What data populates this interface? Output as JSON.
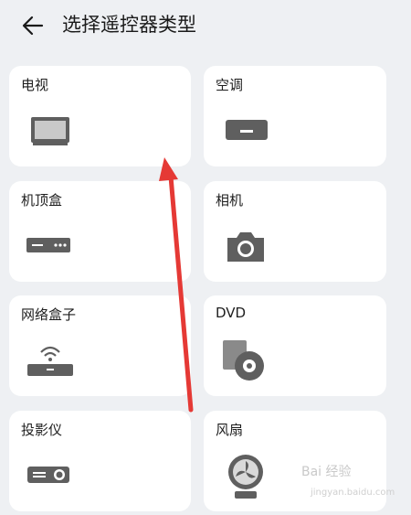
{
  "header": {
    "title": "选择遥控器类型"
  },
  "devices": [
    {
      "label": "电视",
      "icon": "tv-icon"
    },
    {
      "label": "空调",
      "icon": "air-conditioner-icon"
    },
    {
      "label": "机顶盒",
      "icon": "set-top-box-icon"
    },
    {
      "label": "相机",
      "icon": "camera-icon"
    },
    {
      "label": "网络盒子",
      "icon": "network-box-icon"
    },
    {
      "label": "DVD",
      "icon": "dvd-icon"
    },
    {
      "label": "投影仪",
      "icon": "projector-icon"
    },
    {
      "label": "风扇",
      "icon": "fan-icon"
    }
  ],
  "watermark": {
    "text": "Bai 经验",
    "url_text": "jingyan.baidu.com"
  },
  "colors": {
    "background": "#eef0f3",
    "card": "#ffffff",
    "icon": "#5f5f5f",
    "annotation_arrow": "#e53935"
  }
}
